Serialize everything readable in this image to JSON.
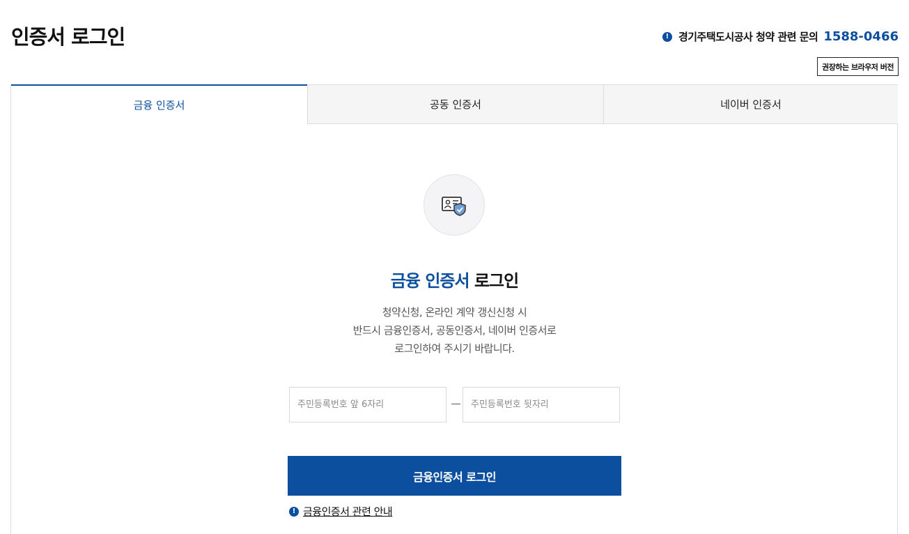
{
  "header": {
    "title": "인증서 로그인",
    "inquiry_icon": "info-icon",
    "inquiry_label": "경기주택도시공사 청약 관련 문의",
    "inquiry_phone": "1588-0466",
    "browser_button_label": "권장하는 브라우저 버전"
  },
  "tabs": [
    {
      "label": "금융 인증서",
      "active": true
    },
    {
      "label": "공동 인증서",
      "active": false
    },
    {
      "label": "네이버 인증서",
      "active": false
    }
  ],
  "main": {
    "icon": "certificate-shield-icon",
    "heading_accent": "금융 인증서",
    "heading_rest": "로그인",
    "description": [
      "청약신청, 온라인 계약 갱신신청 시",
      "반드시 금융인증서, 공동인증서, 네이버 인증서로",
      "로그인하여 주시기 바랍니다."
    ],
    "ssn_front_placeholder": "주민등록번호 앞 6자리",
    "ssn_back_placeholder": "주민등록번호 뒷자리",
    "login_button_label": "금융인증서 로그인",
    "guide_icon": "info-icon",
    "guide_link_label": "금융인증서 관련 안내"
  },
  "colors": {
    "accent": "#0b4f9e",
    "tab_inactive_bg": "#f5f5f6",
    "border": "#dcdcdc"
  }
}
